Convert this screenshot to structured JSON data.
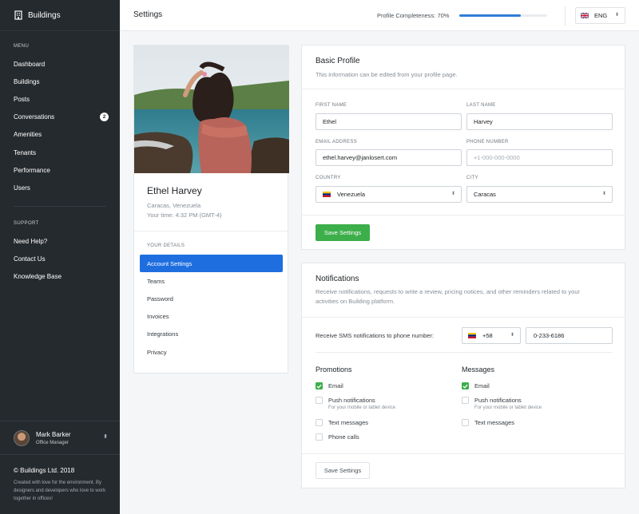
{
  "app": {
    "brand": "Buildings"
  },
  "sidebar": {
    "menu_label": "MENU",
    "items": [
      {
        "label": "Dashboard"
      },
      {
        "label": "Buildings"
      },
      {
        "label": "Posts"
      },
      {
        "label": "Conversations",
        "badge": "2"
      },
      {
        "label": "Amenities"
      },
      {
        "label": "Tenants"
      },
      {
        "label": "Performance"
      },
      {
        "label": "Users"
      }
    ],
    "support_label": "SUPPORT",
    "support_items": [
      {
        "label": "Need Help?"
      },
      {
        "label": "Contact Us"
      },
      {
        "label": "Knowledge Base"
      }
    ],
    "user": {
      "name": "Mark Barker",
      "role": "Office Manager"
    },
    "footer": {
      "copyright": "© Buildings Ltd. 2018",
      "note": "Created with love for the environment. By designers and developers who love to work together in offices!"
    }
  },
  "header": {
    "title": "Settings",
    "completeness_label": "Profile Completeness: 70%",
    "completeness_value": 0.7,
    "language": "ENG"
  },
  "profile": {
    "name": "Ethel Harvey",
    "location": "Caracas, Venezuela",
    "time": "Your time: 4:32 PM (GMT-4)",
    "details_label": "YOUR DETAILS",
    "nav": [
      {
        "label": "Account Settings",
        "active": true
      },
      {
        "label": "Teams"
      },
      {
        "label": "Password"
      },
      {
        "label": "Invoices"
      },
      {
        "label": "Integrations"
      },
      {
        "label": "Privacy"
      }
    ]
  },
  "basic_profile": {
    "title": "Basic Profile",
    "subtitle": "This information can be edited from your profile page.",
    "first_name_label": "FIRST NAME",
    "first_name": "Ethel",
    "last_name_label": "LAST NAME",
    "last_name": "Harvey",
    "email_label": "EMAIL ADDRESS",
    "email": "ethel.harvey@janlosert.com",
    "phone_label": "PHONE NUMBER",
    "phone_placeholder": "+1-000-000-0000",
    "country_label": "COUNTRY",
    "country": "Venezuela",
    "city_label": "CITY",
    "city": "Caracas",
    "save_label": "Save Settings"
  },
  "notifications": {
    "title": "Notifications",
    "subtitle": "Receive notifications, requests to write a review, pricing notices, and other reminders related to your activities on Building platform.",
    "sms_label": "Receive SMS notifications to phone number:",
    "sms_code": "+58",
    "sms_number": "0-233-6186",
    "promotions": {
      "title": "Promotions",
      "options": [
        {
          "label": "Email",
          "checked": true,
          "hint": ""
        },
        {
          "label": "Push notifications",
          "checked": false,
          "hint": "For your mobile or tablet device"
        },
        {
          "label": "Text messages",
          "checked": false,
          "hint": ""
        },
        {
          "label": "Phone calls",
          "checked": false,
          "hint": ""
        }
      ]
    },
    "messages": {
      "title": "Messages",
      "options": [
        {
          "label": "Email",
          "checked": true,
          "hint": ""
        },
        {
          "label": "Push notifications",
          "checked": false,
          "hint": "For your mobile or tablet device"
        },
        {
          "label": "Text messages",
          "checked": false,
          "hint": ""
        }
      ]
    },
    "save_label": "Save Settings"
  },
  "colors": {
    "sidebar": "#252a2e",
    "accent": "#1f6ee0",
    "success": "#3cae4a",
    "progress": "#2f7ed8"
  }
}
